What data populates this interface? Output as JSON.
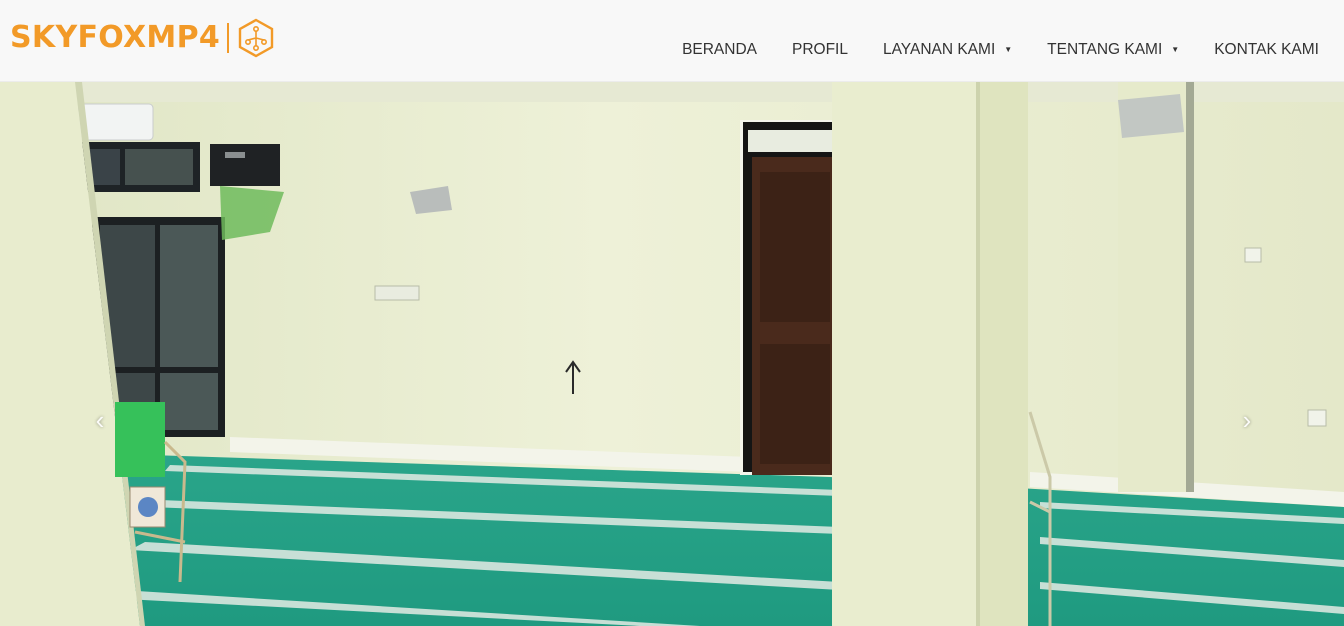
{
  "brand": {
    "name": "SKYFOXMP4",
    "accent_color": "#f29a28",
    "icon": "hexagon-circuit-logo-icon"
  },
  "nav": {
    "items": [
      {
        "label": "BERANDA",
        "dropdown": false
      },
      {
        "label": "PROFIL",
        "dropdown": false
      },
      {
        "label": "LAYANAN KAMI",
        "dropdown": true
      },
      {
        "label": "TENTANG KAMI",
        "dropdown": true
      },
      {
        "label": "KONTAK KAMI",
        "dropdown": false
      }
    ],
    "caret_glyph": "▼"
  },
  "carousel": {
    "prev_glyph": "‹",
    "next_glyph": "›",
    "prev_icon": "chevron-left-icon",
    "next_icon": "chevron-right-icon"
  }
}
